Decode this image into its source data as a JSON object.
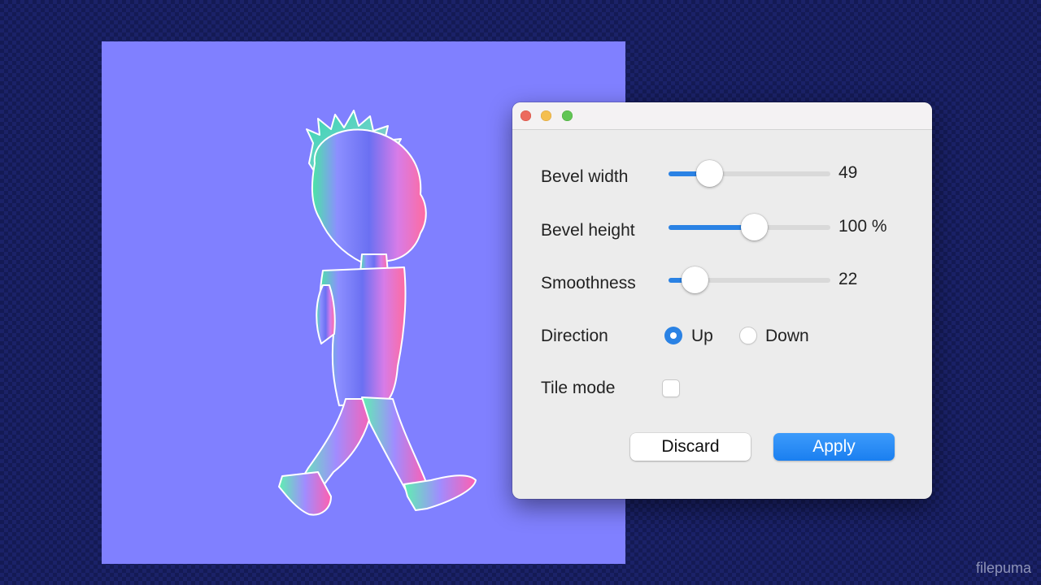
{
  "window": {
    "traffic_lights": {
      "close_color": "#ec6a5e",
      "minimize_color": "#f4bf4f",
      "maximize_color": "#61c554"
    }
  },
  "canvas": {
    "background_color": "#8080ff",
    "subject_icon": "walking-boy-normal-map"
  },
  "settings": {
    "bevel_width": {
      "label": "Bevel width",
      "value_text": "49",
      "fraction": 0.25
    },
    "bevel_height": {
      "label": "Bevel height",
      "value_text": "100 %",
      "fraction": 0.53
    },
    "smoothness": {
      "label": "Smoothness",
      "value_text": "22",
      "fraction": 0.16
    },
    "direction": {
      "label": "Direction",
      "options": [
        {
          "label": "Up",
          "selected": true
        },
        {
          "label": "Down",
          "selected": false
        }
      ]
    },
    "tile_mode": {
      "label": "Tile mode",
      "checked": false
    }
  },
  "buttons": {
    "discard": "Discard",
    "apply": "Apply"
  },
  "watermark": "filepuma",
  "colors": {
    "accent": "#2a82e4",
    "background": "#141a55"
  }
}
